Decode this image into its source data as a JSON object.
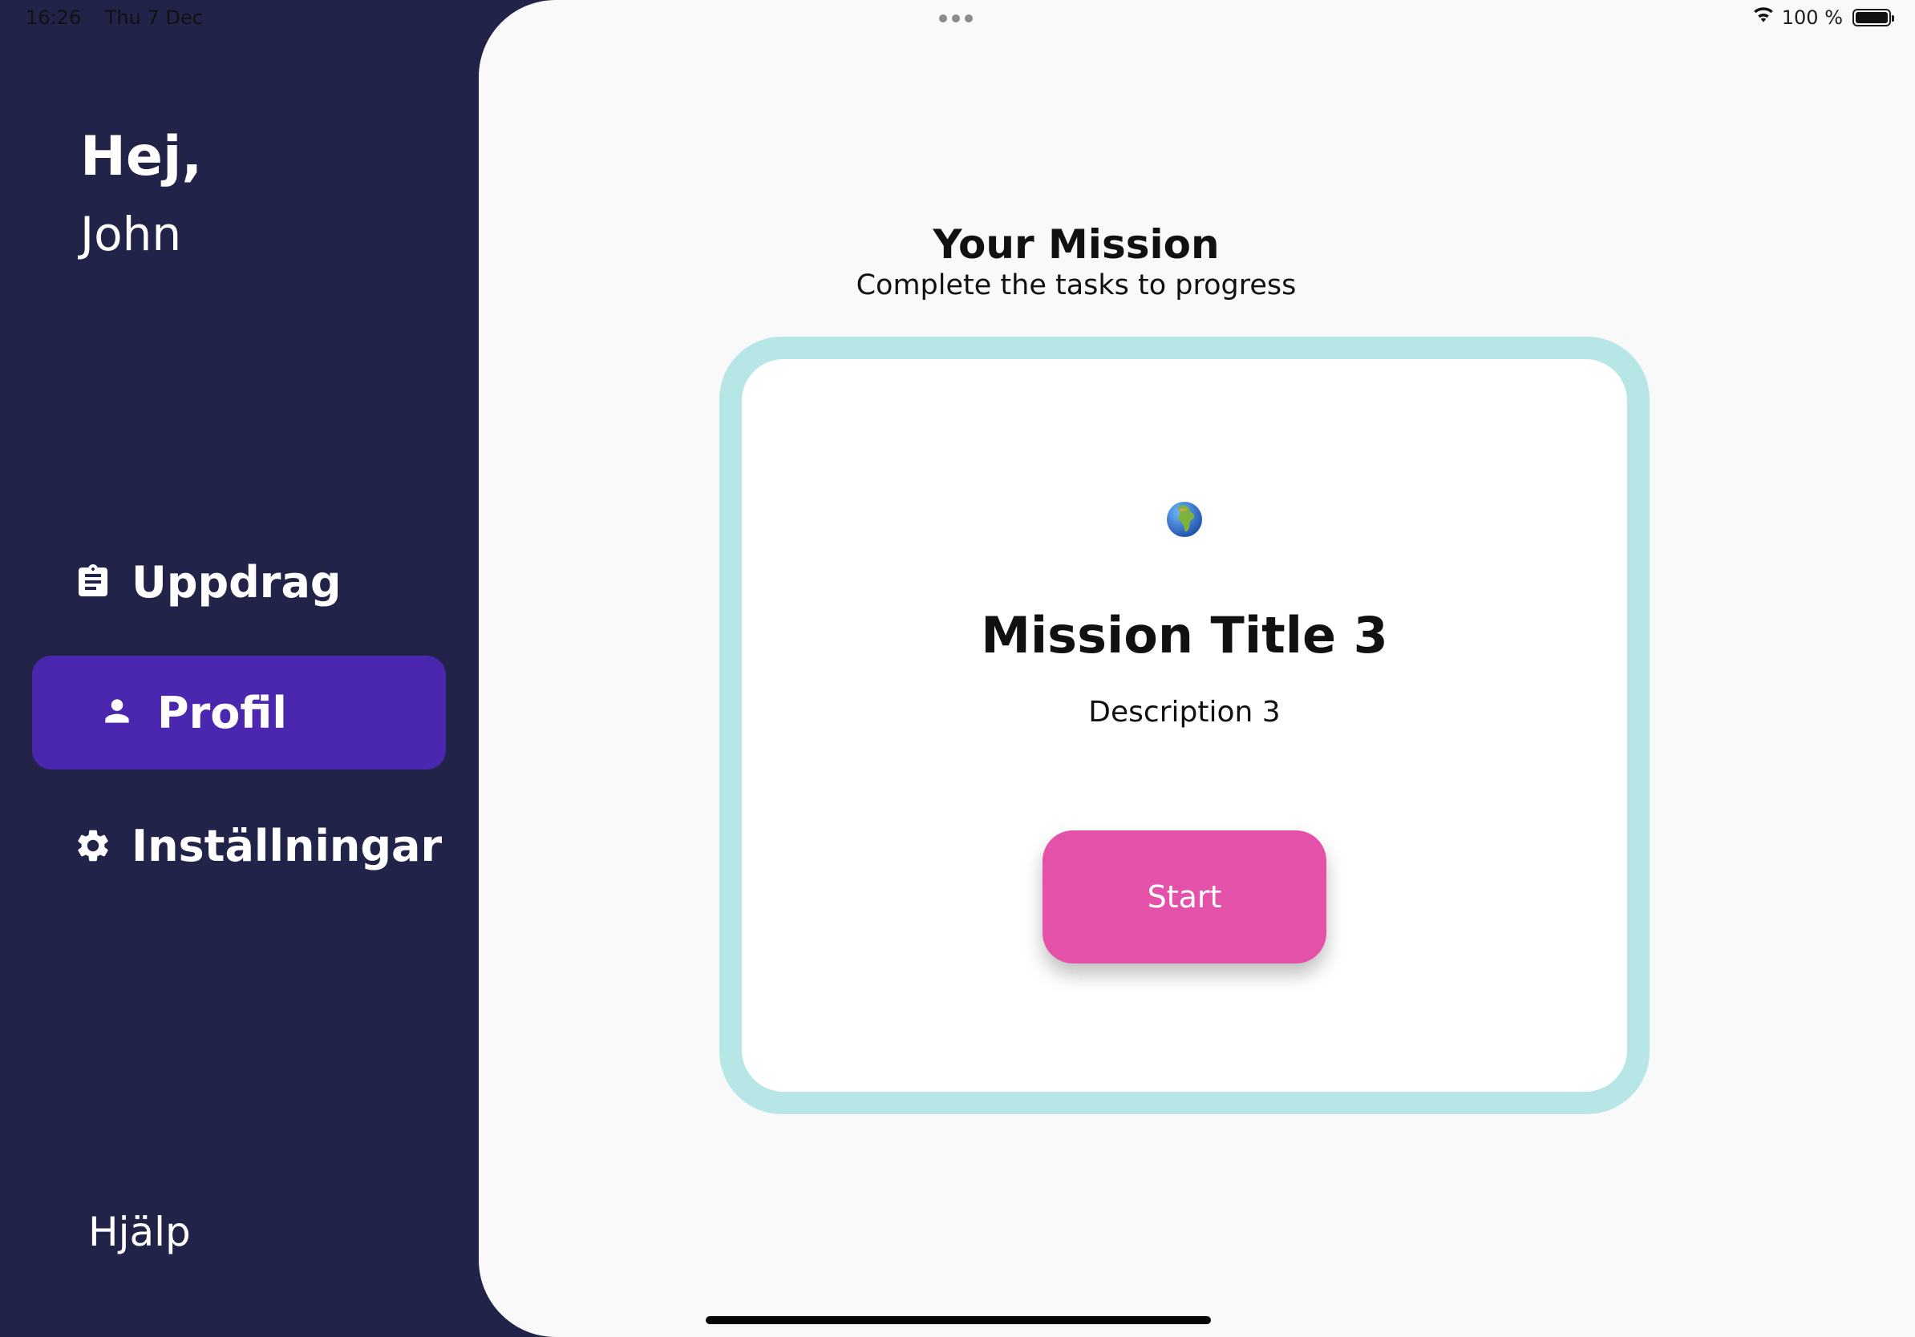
{
  "status_bar": {
    "time": "16:26",
    "date": "Thu 7 Dec",
    "battery": "100 %"
  },
  "sidebar": {
    "greeting": "Hej,",
    "username": "John",
    "items": [
      {
        "label": "Uppdrag",
        "icon": "clipboard-icon",
        "active": false
      },
      {
        "label": "Profil",
        "icon": "person-icon",
        "active": true
      },
      {
        "label": "Inställningar",
        "icon": "gear-icon",
        "active": false
      }
    ],
    "help_label": "Hjälp"
  },
  "main": {
    "title": "Your Mission",
    "subtitle": "Complete the tasks to progress",
    "card": {
      "icon": "globe-africa-icon",
      "title": "Mission Title 3",
      "description": "Description 3",
      "button_label": "Start"
    }
  },
  "colors": {
    "sidebar_bg": "#222349",
    "active_item": "#4a27ae",
    "card_border": "#b6e6e6",
    "start_button": "#e451a9",
    "main_bg": "#f9f9f9"
  }
}
